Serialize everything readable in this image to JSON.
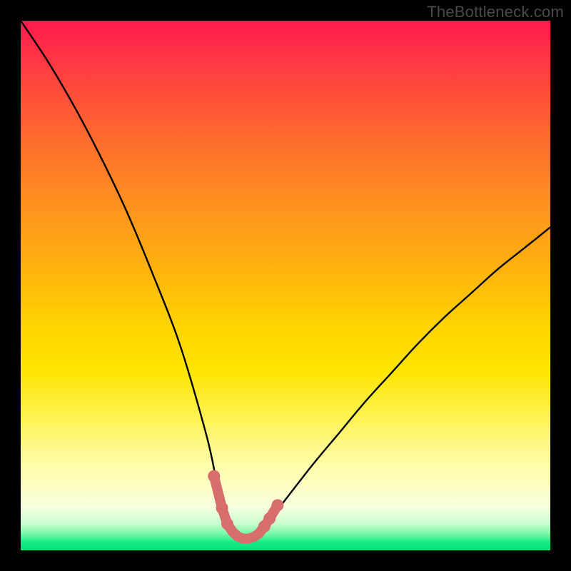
{
  "watermark": "TheBottleneck.com",
  "chart_data": {
    "type": "line",
    "title": "",
    "xlabel": "",
    "ylabel": "",
    "xlim": [
      0,
      100
    ],
    "ylim": [
      0,
      100
    ],
    "grid": false,
    "legend": false,
    "series": [
      {
        "name": "bottleneck-curve",
        "x": [
          0,
          5,
          10,
          15,
          20,
          25,
          30,
          35,
          37,
          38,
          39,
          40,
          41,
          42,
          43,
          44,
          45,
          46,
          48,
          55,
          60,
          65,
          70,
          75,
          80,
          85,
          90,
          95,
          100
        ],
        "values": [
          100,
          92.5,
          84,
          74.5,
          64,
          52,
          39,
          22,
          13,
          9,
          6,
          4,
          2.5,
          2,
          2,
          2.2,
          3,
          4.5,
          7,
          16,
          22,
          28,
          33.5,
          39,
          44,
          48.5,
          53,
          57,
          61
        ]
      }
    ],
    "markers": {
      "name": "optimal-range",
      "x": [
        36.5,
        38,
        39,
        40,
        41,
        42,
        43,
        44,
        45,
        46,
        47,
        48.5
      ],
      "values": [
        14,
        8,
        5,
        3.5,
        2.6,
        2.2,
        2.2,
        2.5,
        3.2,
        4.5,
        6,
        8.5
      ]
    },
    "colors": {
      "gradient_top": "#ff1a4d",
      "gradient_mid": "#ffe500",
      "gradient_bottom": "#00e37a",
      "curve": "#000000",
      "marker": "#d76d6d",
      "frame": "#000000"
    }
  }
}
